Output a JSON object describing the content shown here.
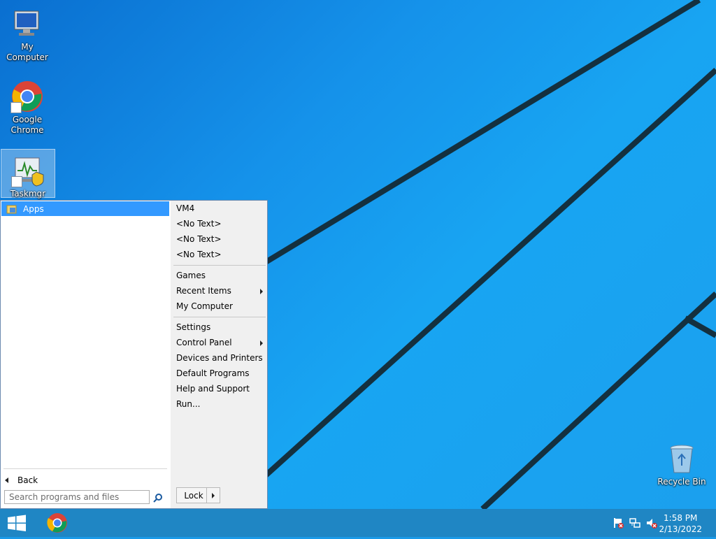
{
  "desktop": {
    "icons": [
      {
        "label": "My Computer"
      },
      {
        "label": "Google\nChrome"
      },
      {
        "label": "Taskmgr"
      },
      {
        "label": "Recycle Bin"
      }
    ]
  },
  "start_menu": {
    "apps_label": "Apps",
    "back_label": "Back",
    "search_placeholder": "Search programs and files",
    "right_items": {
      "vm4": "VM4",
      "no_text_1": "<No Text>",
      "no_text_2": "<No Text>",
      "no_text_3": "<No Text>",
      "games": "Games",
      "recent_items": "Recent Items",
      "my_computer": "My Computer",
      "settings": "Settings",
      "control_panel": "Control Panel",
      "devices_printers": "Devices and Printers",
      "default_programs": "Default Programs",
      "help_support": "Help and Support",
      "run": "Run..."
    },
    "lock_label": "Lock"
  },
  "taskbar": {
    "clock_time": "1:58 PM",
    "clock_date": "2/13/2022"
  },
  "colors": {
    "highlight": "#3399ff",
    "taskbar": "#1f86c4",
    "desktop": "#18a5f2"
  }
}
